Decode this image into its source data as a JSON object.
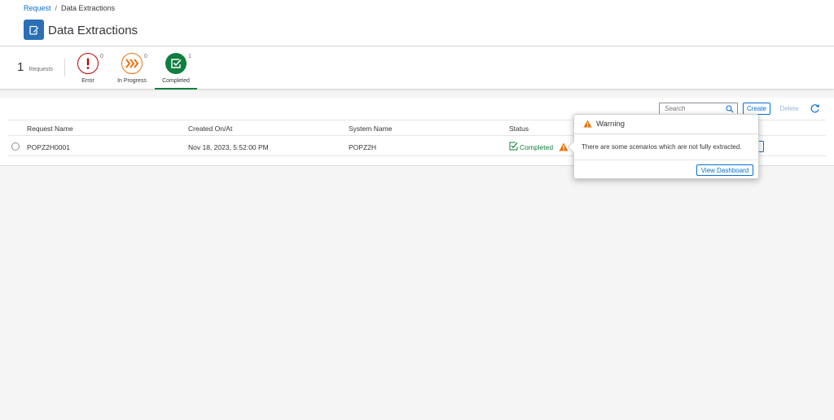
{
  "breadcrumb": {
    "parent": "Request",
    "separator": "/",
    "current": "Data Extractions"
  },
  "page": {
    "title": "Data Extractions",
    "icon": "edit-document-icon"
  },
  "summary": {
    "count": "1",
    "label": "Requests"
  },
  "status_tabs": [
    {
      "label": "Error",
      "count": "0",
      "icon": "exclamation-icon",
      "color": "#bb0000"
    },
    {
      "label": "In Progress",
      "count": "0",
      "icon": "fast-forward-icon",
      "color": "#e9730c"
    },
    {
      "label": "Completed",
      "count": "1",
      "icon": "checkbox-icon",
      "color": "#107e3e"
    }
  ],
  "toolbar": {
    "search_placeholder": "Search",
    "create_label": "Create",
    "delete_label": "Delete"
  },
  "table": {
    "columns": [
      "Request Name",
      "Created On/At",
      "System Name",
      "Status"
    ],
    "rows": [
      {
        "request_name": "POPZ2H0001",
        "created": "Nov 18, 2023, 5:52:00 PM",
        "system": "POPZ2H",
        "status": "Completed"
      }
    ]
  },
  "popover": {
    "title": "Warning",
    "message": "There are some scenarios which are not fully extracted.",
    "button_label": "View Dashboard"
  },
  "colors": {
    "accent": "#0a6ed1",
    "success": "#107e3e",
    "warning": "#e9730c",
    "error": "#bb0000"
  }
}
